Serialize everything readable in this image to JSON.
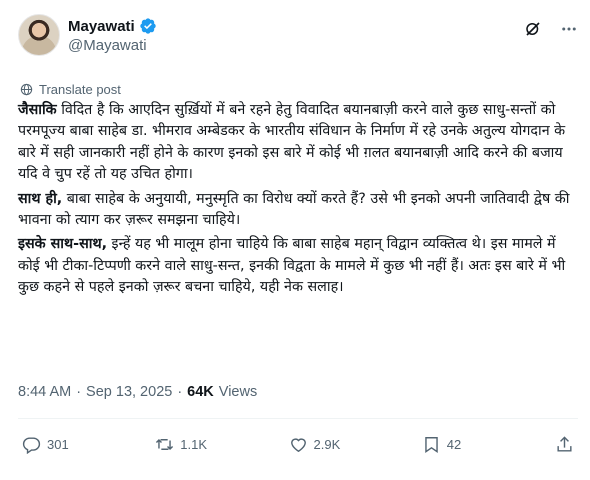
{
  "author": {
    "display_name": "Mayawati",
    "handle": "@Mayawati",
    "verified_color": "#1d9bf0"
  },
  "translate_label": "Translate post",
  "body": {
    "p1_bold": "जैसाकि",
    "p1_rest": " विदित है कि आएदिन सुर्ख़ियों में बने रहने हेतु विवादित बयानबाज़ी करने वाले कुछ साधु-सन्तों को परमपूज्य बाबा साहेब डा. भीमराव अम्बेडकर के भारतीय संविधान के निर्माण में रहे उनके अतुल्य योगदान के बारे में सही जानकारी नहीं होने के कारण इनको इस बारे में कोई भी ग़लत बयानबाज़ी आदि करने की बजाय यदि वे चुप रहें तो यह उचित होगा।",
    "p2_bold": "साथ ही,",
    "p2_rest": " बाबा साहेब के अनुयायी, मनुस्मृति का विरोध क्यों करते हैं? उसे भी इनको अपनी जातिवादी द्वेष की भावना को त्याग कर ज़रूर समझना चाहिये।",
    "p3_bold": "इसके साथ-साथ,",
    "p3_rest": " इन्हें यह भी मालूम होना चाहिये कि बाबा साहेब महान् विद्वान व्यक्तित्व थे। इस मामले में कोई भी टीका-टिप्पणी करने वाले साधु-सन्त, इनकी विद्वता के मामले में कुछ भी नहीं हैं। अतः इस बारे में भी कुछ कहने से पहले इनको ज़रूर बचना चाहिये, यही नेक सलाह।"
  },
  "meta": {
    "time": "8:44 AM",
    "dot1": "·",
    "date": "Sep 13, 2025",
    "dot2": "·",
    "views_count": "64K",
    "views_label": "Views"
  },
  "actions": {
    "replies": "301",
    "reposts": "1.1K",
    "likes": "2.9K",
    "bookmarks": "42"
  },
  "icons": [
    "verified-badge-icon",
    "grok-icon",
    "more-icon",
    "translate-icon",
    "reply-icon",
    "repost-icon",
    "like-icon",
    "bookmark-icon",
    "share-icon"
  ]
}
